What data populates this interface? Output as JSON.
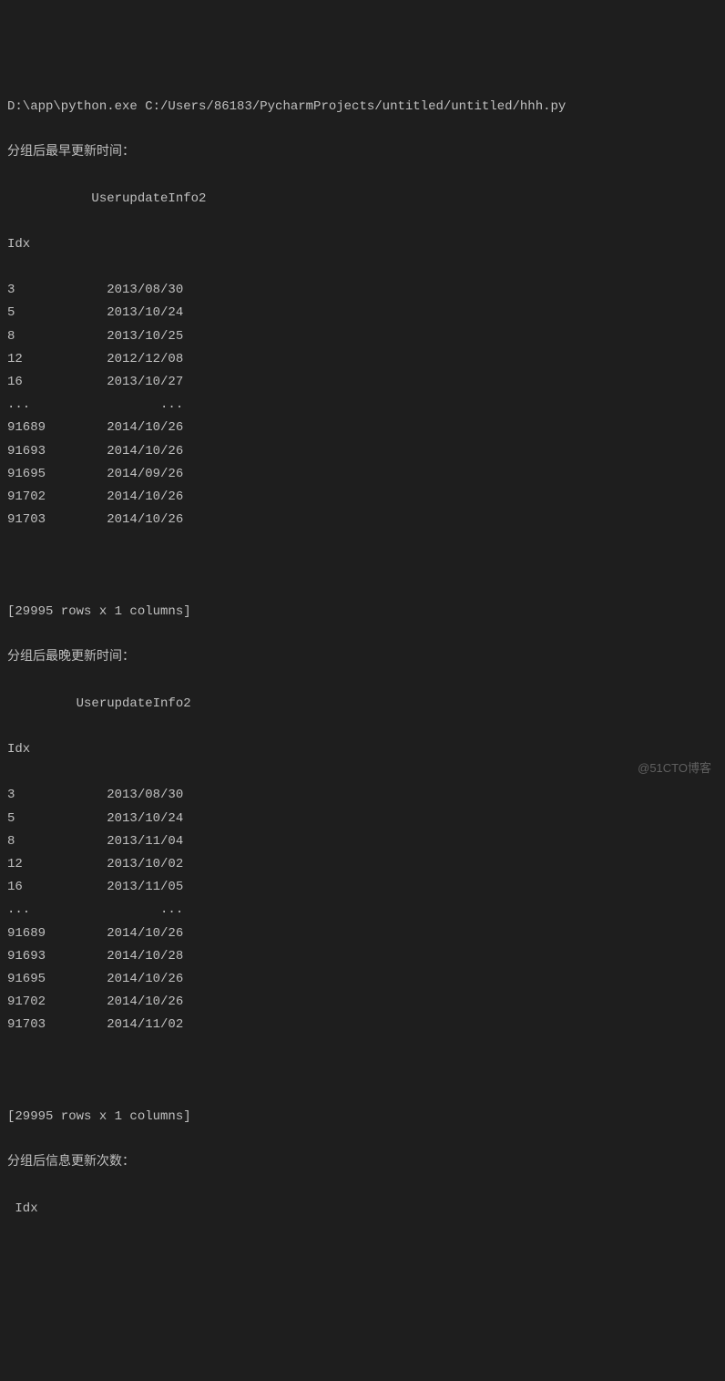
{
  "command": "D:\\app\\python.exe C:/Users/86183/PycharmProjects/untitled/untitled/hhh.py",
  "section1": {
    "title": "分组后最早更新时间：",
    "column_header": "           UserupdateInfo2",
    "index_header": "Idx",
    "rows": [
      {
        "idx": "3",
        "value": "2013/08/30"
      },
      {
        "idx": "5",
        "value": "2013/10/24"
      },
      {
        "idx": "8",
        "value": "2013/10/25"
      },
      {
        "idx": "12",
        "value": "2012/12/08"
      },
      {
        "idx": "16",
        "value": "2013/10/27"
      },
      {
        "idx": "...",
        "value": "       ..."
      },
      {
        "idx": "91689",
        "value": "2014/10/26"
      },
      {
        "idx": "91693",
        "value": "2014/10/26"
      },
      {
        "idx": "91695",
        "value": "2014/09/26"
      },
      {
        "idx": "91702",
        "value": "2014/10/26"
      },
      {
        "idx": "91703",
        "value": "2014/10/26"
      }
    ],
    "summary": "[29995 rows x 1 columns]"
  },
  "section2": {
    "title": "分组后最晚更新时间：",
    "column_header": "         UserupdateInfo2",
    "index_header": "Idx",
    "rows": [
      {
        "idx": "3",
        "value": "2013/08/30"
      },
      {
        "idx": "5",
        "value": "2013/10/24"
      },
      {
        "idx": "8",
        "value": "2013/11/04"
      },
      {
        "idx": "12",
        "value": "2013/10/02"
      },
      {
        "idx": "16",
        "value": "2013/11/05"
      },
      {
        "idx": "...",
        "value": "       ..."
      },
      {
        "idx": "91689",
        "value": "2014/10/26"
      },
      {
        "idx": "91693",
        "value": "2014/10/28"
      },
      {
        "idx": "91695",
        "value": "2014/10/26"
      },
      {
        "idx": "91702",
        "value": "2014/10/26"
      },
      {
        "idx": "91703",
        "value": "2014/11/02"
      }
    ],
    "summary": "[29995 rows x 1 columns]"
  },
  "section3": {
    "title": "分组后信息更新次数：",
    "index_header": " Idx"
  },
  "watermark": "@51CTO博客"
}
